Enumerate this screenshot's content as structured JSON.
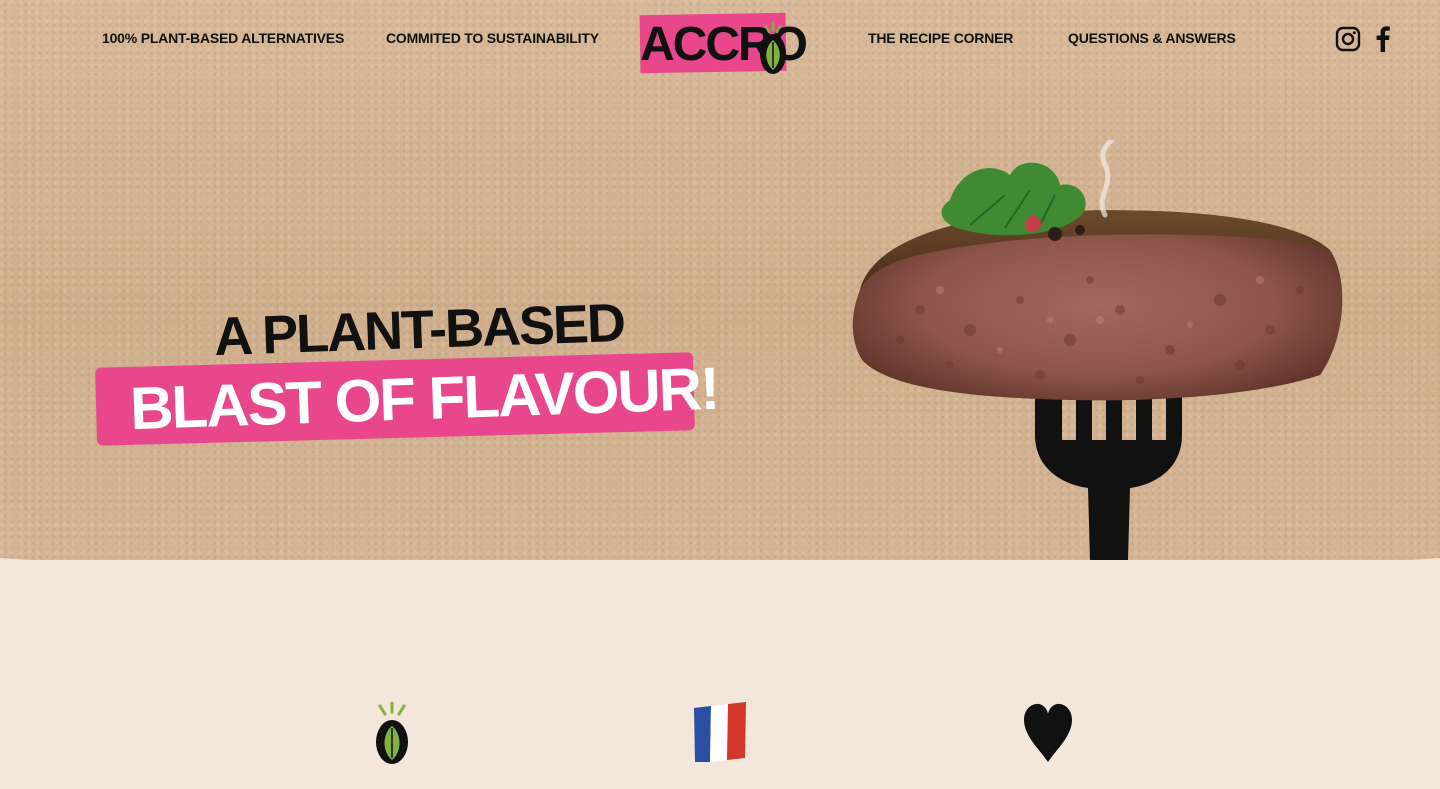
{
  "nav": {
    "left_links": [
      "100% Plant-based alternatives",
      "Commited to sustainability"
    ],
    "right_links": [
      "The recipe corner",
      "Questions & Answers"
    ],
    "logo_text": "ACCRO",
    "social": [
      "instagram-icon",
      "facebook-icon"
    ]
  },
  "hero": {
    "line1": "A PLANT-BASED",
    "line2": "BLAST OF FLAVOUR!"
  },
  "features": [
    "plant-leaf-icon",
    "french-flag-icon",
    "heart-icon"
  ],
  "colors": {
    "accent_pink": "#e8478c",
    "kraft": "#d2b293",
    "paper": "#f3e6da",
    "ink": "#111111",
    "leaf_green": "#7fb241"
  }
}
